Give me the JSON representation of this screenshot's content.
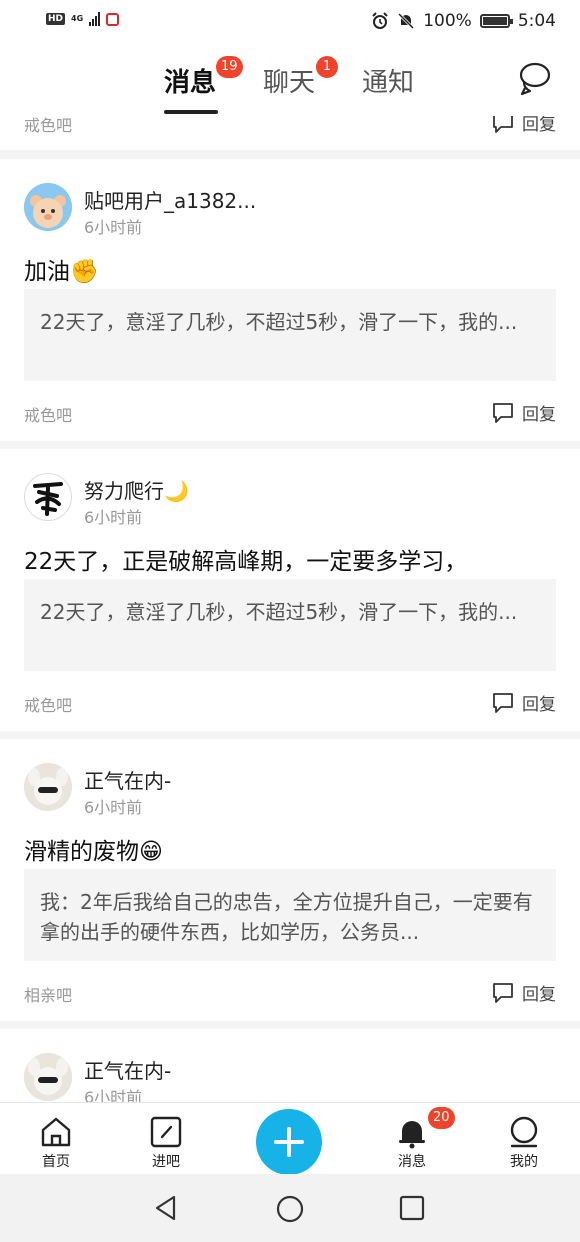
{
  "status_bar": {
    "hd": "HD",
    "network": "4G",
    "battery": "100%",
    "time": "5:04"
  },
  "header": {
    "tabs": [
      {
        "label": "消息",
        "badge": "19",
        "active": true
      },
      {
        "label": "聊天",
        "badge": "1",
        "active": false
      },
      {
        "label": "通知",
        "badge": "",
        "active": false
      }
    ]
  },
  "top_partial": {
    "forum": "戒色吧",
    "reply_label": "回复"
  },
  "cards": [
    {
      "username": "贴吧用户_a1382...",
      "time": "6小时前",
      "text": "加油✊",
      "quote": "22天了，意淫了几秒，不超过5秒，滑了一下，我的...",
      "forum": "戒色吧",
      "reply_label": "回复"
    },
    {
      "username": "努力爬行🌙",
      "time": "6小时前",
      "text": "22天了，正是破解高峰期，一定要多学习，",
      "quote": "22天了，意淫了几秒，不超过5秒，滑了一下，我的...",
      "forum": "戒色吧",
      "reply_label": "回复"
    },
    {
      "username": "正气在内-",
      "time": "6小时前",
      "text": "滑精的废物😁",
      "quote": "我：2年后我给自己的忠告，全方位提升自己，一定要有拿的出手的硬件东西，比如学历，公务员...",
      "forum": "相亲吧",
      "reply_label": "回复"
    },
    {
      "username": "正气在内-",
      "time": "6小时前"
    }
  ],
  "bottom_nav": {
    "home": "首页",
    "enter_bar": "进吧",
    "messages": "消息",
    "messages_badge": "20",
    "mine": "我的"
  },
  "colors": {
    "accent_blue": "#17b3e8",
    "badge_red": "#f0432b"
  }
}
